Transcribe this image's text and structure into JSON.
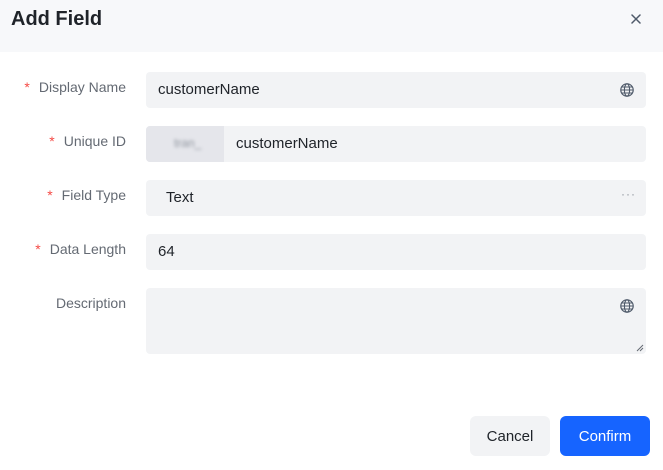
{
  "dialog": {
    "title": "Add Field"
  },
  "form": {
    "display_name": {
      "label": "Display Name",
      "required": "*",
      "value": "customerName"
    },
    "unique_id": {
      "label": "Unique ID",
      "required": "*",
      "prefix": "tran_",
      "value": "customerName"
    },
    "field_type": {
      "label": "Field Type",
      "required": "*",
      "value": "Text",
      "more": "···"
    },
    "data_length": {
      "label": "Data Length",
      "required": "*",
      "value": "64"
    },
    "description": {
      "label": "Description",
      "value": ""
    }
  },
  "footer": {
    "cancel_label": "Cancel",
    "confirm_label": "Confirm"
  },
  "icons": {
    "close": "close-icon",
    "globe": "globe-icon",
    "more": "more-icon"
  },
  "colors": {
    "primary": "#1664ff",
    "required": "#f54a45",
    "header_bg": "#f7f8fa",
    "input_bg": "#f2f3f5"
  }
}
